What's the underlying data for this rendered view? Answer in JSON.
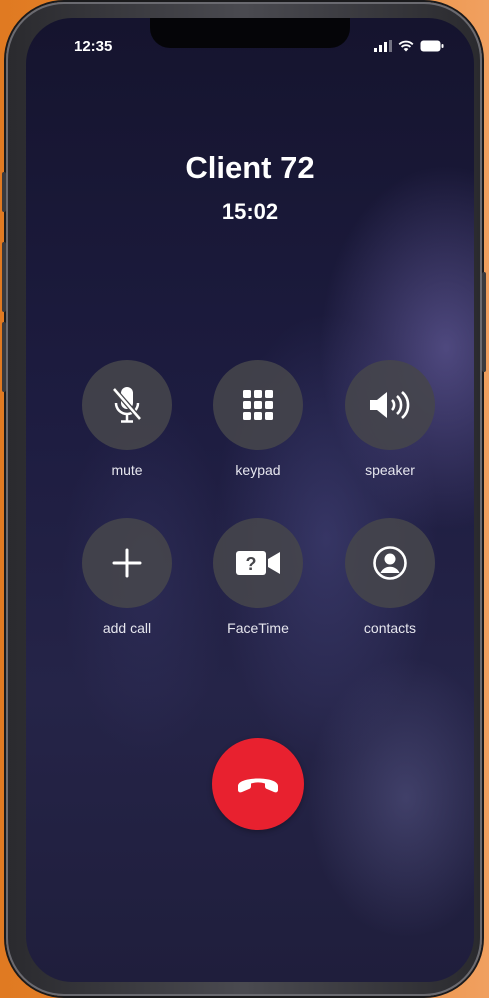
{
  "status_bar": {
    "time": "12:35"
  },
  "call": {
    "caller_name": "Client 72",
    "duration": "15:02"
  },
  "actions": [
    {
      "label": "mute",
      "icon": "mic-slash-icon"
    },
    {
      "label": "keypad",
      "icon": "keypad-icon"
    },
    {
      "label": "speaker",
      "icon": "speaker-icon"
    },
    {
      "label": "add call",
      "icon": "plus-icon"
    },
    {
      "label": "FaceTime",
      "icon": "facetime-icon"
    },
    {
      "label": "contacts",
      "icon": "contact-icon"
    }
  ],
  "colors": {
    "end_call": "#e8212f",
    "button_bg": "#46464b",
    "background": "#1d1c40",
    "frame_backdrop": "#e8812a"
  }
}
